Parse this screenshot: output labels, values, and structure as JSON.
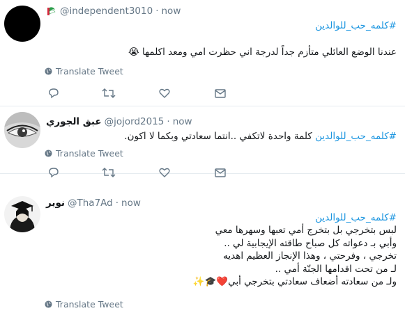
{
  "tweets": [
    {
      "handle": "@independent3010",
      "display_name": "",
      "time": "now",
      "hashtag": "#كلمه_حب_للوالدين",
      "body": "عندنا الوضع العائلي متأزم جداً لدرجة اني حظرت امي ومعد اكلمها 😭",
      "translate": "Translate Tweet"
    },
    {
      "display_name": "عبق الجوري",
      "handle": "@jojord2015",
      "time": "now",
      "hashtag": "#كلمه_حب_للوالدين",
      "body": "كلمة واحدة لاتكفي ..انتما سعادتي وبكما لا اكون.",
      "translate": "Translate Tweet"
    },
    {
      "display_name": "نوير",
      "handle": "@Tha7Ad",
      "time": "now",
      "hashtag": "#كلمه_حب_للوالدين",
      "lines": [
        "لبس بتخرجي بل بتخرج أمي تعبها وسهرها معي",
        "وأبي بـ دعواته كل صباح طاقته الإيجابية لي ..",
        "تخرجي ، وفرحتي ، وهذا الإنجاز العظيم اهديه",
        "لـ من تحت اقدامها الجنّة أمي ..",
        "ولـ من سعادته أضعاف سعادتي بتخرجي  أبي❤️🎓✨"
      ],
      "translate": "Translate Tweet"
    }
  ],
  "icons": {
    "globe": "globe-icon",
    "reply": "reply-icon",
    "retweet": "retweet-icon",
    "like": "heart-icon",
    "dm": "envelope-icon"
  },
  "colors": {
    "hashtag": "#1b95e0",
    "muted": "#657786",
    "divider": "#e6ecf0"
  }
}
